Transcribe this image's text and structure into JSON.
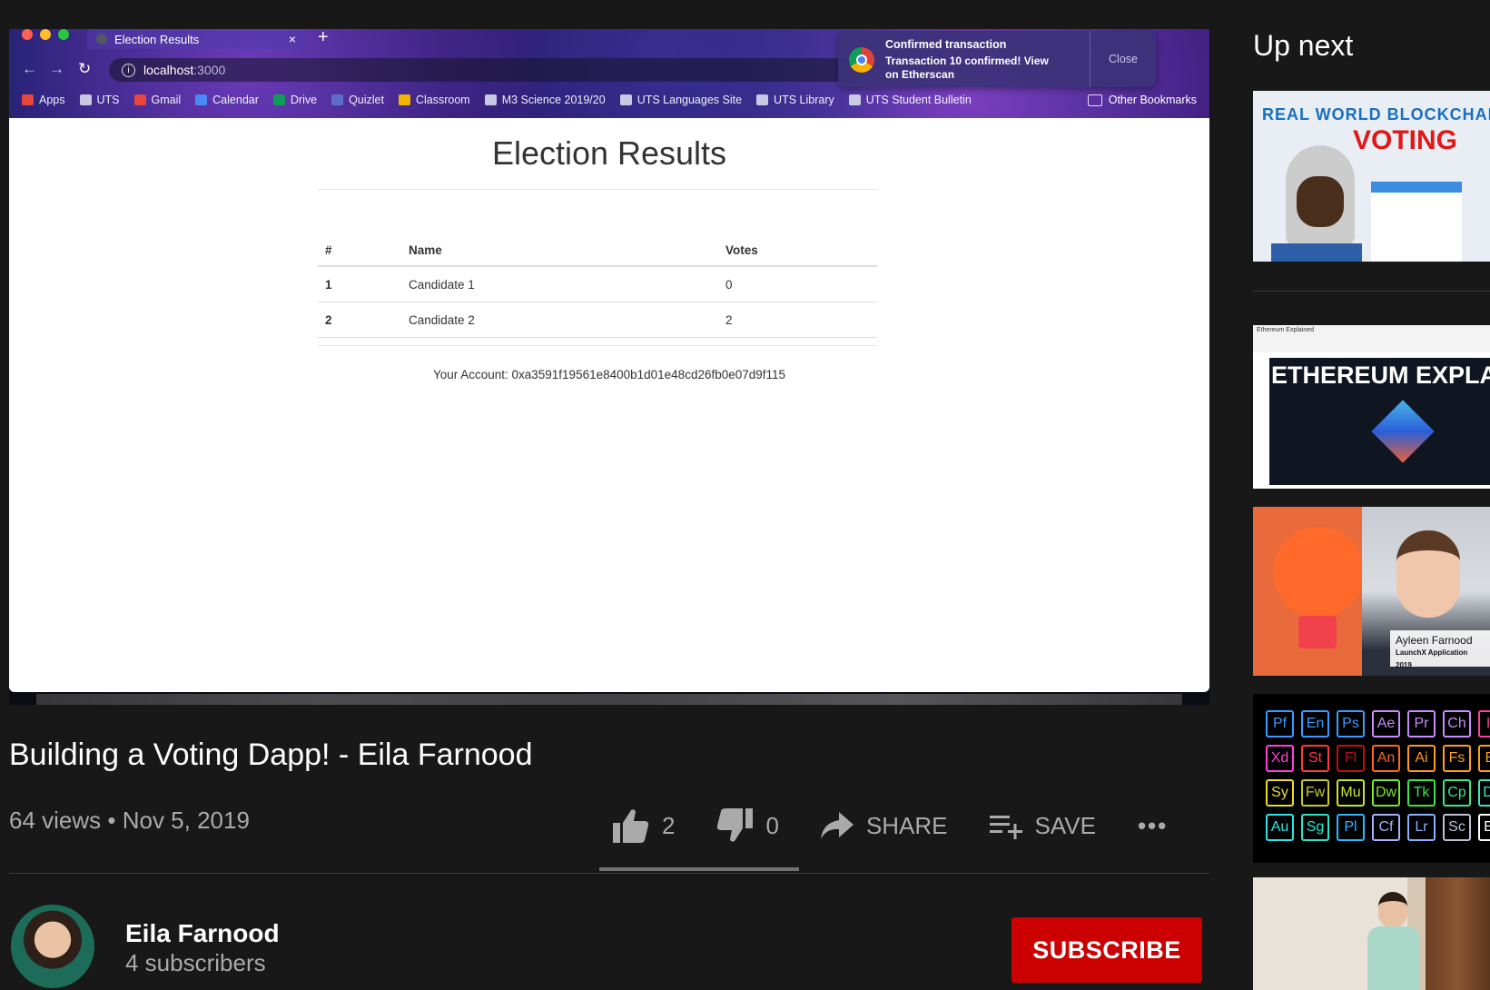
{
  "browser": {
    "tab_title": "Election Results",
    "tab_close": "×",
    "new_tab": "+",
    "url_host": "localhost",
    "url_port": ":3000",
    "bookmarks": [
      "Apps",
      "UTS",
      "Gmail",
      "Calendar",
      "Drive",
      "Quizlet",
      "Classroom",
      "M3 Science 2019/20",
      "UTS Languages Site",
      "UTS Library",
      "UTS Student Bulletin"
    ],
    "other_bookmarks": "Other Bookmarks",
    "notification": {
      "title": "Confirmed transaction",
      "body": "Transaction 10 confirmed! View on Etherscan",
      "close": "Close"
    }
  },
  "page": {
    "title": "Election Results",
    "table": {
      "headers": [
        "#",
        "Name",
        "Votes"
      ],
      "rows": [
        {
          "id": "1",
          "name": "Candidate 1",
          "votes": "0"
        },
        {
          "id": "2",
          "name": "Candidate 2",
          "votes": "2"
        }
      ]
    },
    "account": "Your Account: 0xa3591f19561e8400b1d01e48cd26fb0e07d9f115"
  },
  "video": {
    "title": "Building a Voting Dapp! - Eila Farnood",
    "views": "64 views",
    "date": "Nov 5, 2019",
    "likes": "2",
    "dislikes": "0",
    "share": "SHARE",
    "save": "SAVE",
    "more": "•••"
  },
  "channel": {
    "name": "Eila Farnood",
    "subscribers": "4 subscribers",
    "subscribe": "SUBSCRIBE"
  },
  "sidebar": {
    "heading": "Up next",
    "thumb1": {
      "line1": "REAL WORLD BLOCKCHAIN",
      "line2": "VOTING"
    },
    "thumb2": {
      "header": "Ethereum Explained",
      "title": "ETHEREUM EXPLAINED"
    },
    "thumb3": {
      "name": "Ayleen Farnood",
      "sub": "LaunchX Application 2019"
    },
    "thumb4_tiles": [
      {
        "t": "Pf",
        "c": "#3b9cff"
      },
      {
        "t": "En",
        "c": "#3b9cff"
      },
      {
        "t": "Ps",
        "c": "#3b9cff"
      },
      {
        "t": "Ae",
        "c": "#c98cff"
      },
      {
        "t": "Pr",
        "c": "#c98cff"
      },
      {
        "t": "Ch",
        "c": "#c98cff"
      },
      {
        "t": "Id",
        "c": "#ff3fa3"
      },
      {
        "t": "Xd",
        "c": "#ff3fd6"
      },
      {
        "t": "St",
        "c": "#ff3a3a"
      },
      {
        "t": "Fl",
        "c": "#c01010"
      },
      {
        "t": "An",
        "c": "#ff6a1a"
      },
      {
        "t": "Ai",
        "c": "#ff9a1a"
      },
      {
        "t": "Fs",
        "c": "#ffa01a"
      },
      {
        "t": "Br",
        "c": "#ffa01a"
      },
      {
        "t": "Sy",
        "c": "#e6e02a"
      },
      {
        "t": "Fw",
        "c": "#c8c82a"
      },
      {
        "t": "Mu",
        "c": "#c8e62a"
      },
      {
        "t": "Dw",
        "c": "#7be62a"
      },
      {
        "t": "Tk",
        "c": "#3ee64a"
      },
      {
        "t": "Cp",
        "c": "#3ee68a"
      },
      {
        "t": "Dn",
        "c": "#3ee6c0"
      },
      {
        "t": "Au",
        "c": "#2ae6e6"
      },
      {
        "t": "Sg",
        "c": "#2ae6c8"
      },
      {
        "t": "Pl",
        "c": "#2ab8ff"
      },
      {
        "t": "Cf",
        "c": "#aab0ff"
      },
      {
        "t": "Lr",
        "c": "#8ab0ff"
      },
      {
        "t": "Sc",
        "c": "#c0c0d8"
      },
      {
        "t": "Ex",
        "c": "#ffffff"
      }
    ]
  }
}
